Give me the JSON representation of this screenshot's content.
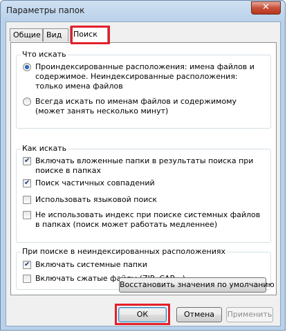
{
  "window": {
    "title": "Параметры папок",
    "close_glyph": "✕"
  },
  "tabs": [
    {
      "label": "Общие",
      "active": false
    },
    {
      "label": "Вид",
      "active": false
    },
    {
      "label": "Поиск",
      "active": true
    }
  ],
  "what_to_search": {
    "legend": "Что искать",
    "options": [
      {
        "label": "Проиндексированные расположения: имена файлов и содержимое. Неиндексированные расположения: только имена файлов",
        "selected": true
      },
      {
        "label": "Всегда искать по именам файлов и содержимому (может занять несколько минут)",
        "selected": false
      }
    ]
  },
  "how_to_search": {
    "legend": "Как искать",
    "options": [
      {
        "label": "Включать вложенные папки в результаты поиска при поиске в папках",
        "checked": true
      },
      {
        "label": "Поиск частичных совпадений",
        "checked": true
      },
      {
        "label": "Использовать языковой поиск",
        "checked": false
      },
      {
        "label": "Не использовать индекс при поиске системных файлов в папках (поиск может работать медленнее)",
        "checked": false
      }
    ]
  },
  "non_indexed": {
    "legend": "При поиске в неиндексированных расположениях",
    "options": [
      {
        "label": "Включать системные папки",
        "checked": true
      },
      {
        "label": "Включать сжатые файлы (ZIP, CAB...)",
        "checked": false
      }
    ]
  },
  "buttons": {
    "restore_defaults": "Восстановить значения по умолчанию",
    "ok": "ОК",
    "cancel": "Отмена",
    "apply": "Применить"
  }
}
